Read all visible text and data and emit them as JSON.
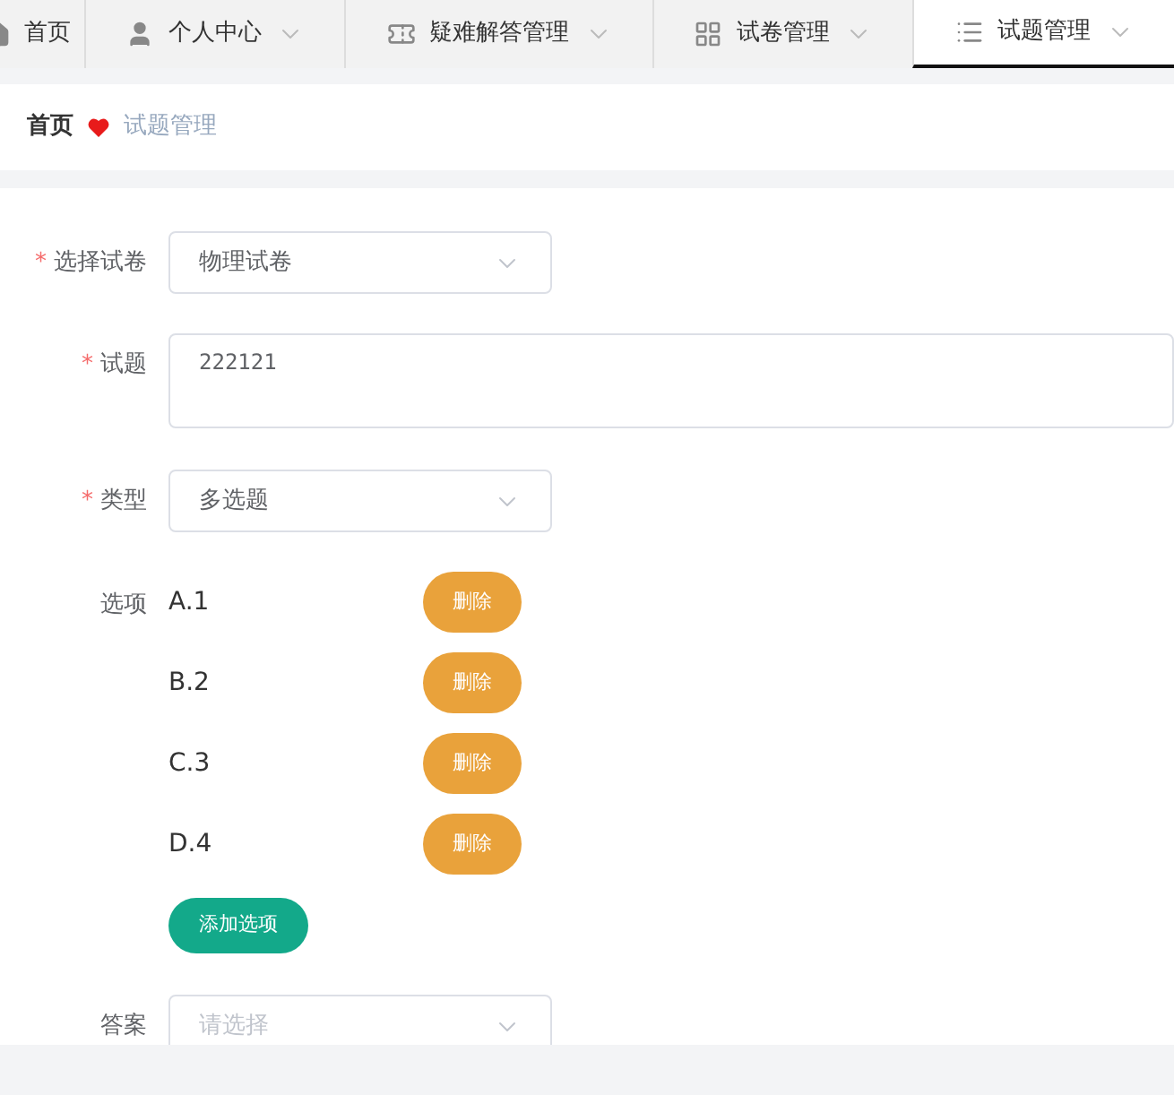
{
  "nav_tabs": [
    {
      "label": "首页",
      "selected": false
    },
    {
      "label": "个人中心",
      "selected": false
    },
    {
      "label": "疑难解答管理",
      "selected": false
    },
    {
      "label": "试卷管理",
      "selected": false
    },
    {
      "label": "试题管理",
      "selected": true
    }
  ],
  "breadcrumb": {
    "home": "首页",
    "current": "试题管理"
  },
  "form": {
    "paper": {
      "label": "选择试卷",
      "mark": "*",
      "value": "物理试卷"
    },
    "question": {
      "label": "试题",
      "mark": "*",
      "value": "222121"
    },
    "type": {
      "label": "类型",
      "mark": "*",
      "value": "多选题"
    },
    "options": {
      "label": "选项",
      "items": [
        {
          "text": "A.1",
          "delete": "删除"
        },
        {
          "text": "B.2",
          "delete": "删除"
        },
        {
          "text": "C.3",
          "delete": "删除"
        },
        {
          "text": "D.4",
          "delete": "删除"
        }
      ],
      "add": "添加选项"
    },
    "answer": {
      "label": "答案",
      "placeholder": "请选择"
    }
  }
}
